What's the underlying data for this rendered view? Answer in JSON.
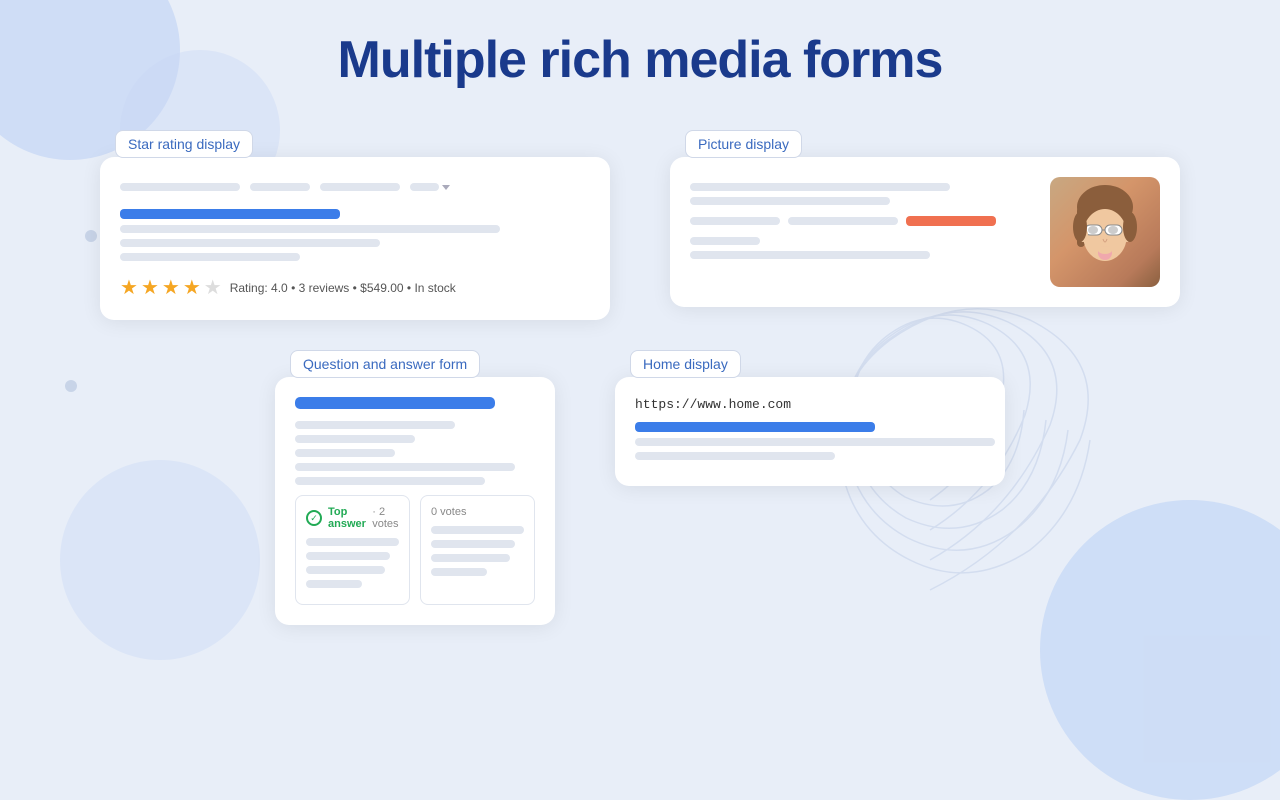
{
  "page": {
    "title": "Multiple rich media forms",
    "background_color": "#e8eef8"
  },
  "cards": {
    "star_rating": {
      "label": "Star rating display",
      "stars_filled": 4,
      "stars_empty": 1,
      "rating_text": "Rating: 4.0",
      "reviews_text": "3 reviews",
      "price_text": "$549.00",
      "stock_text": "In stock"
    },
    "picture_display": {
      "label": "Picture display"
    },
    "qa_form": {
      "label": "Question and answer form",
      "top_answer_label": "Top answer",
      "top_votes": "2 votes",
      "other_votes": "0 votes"
    },
    "home_display": {
      "label": "Home display",
      "url": "https://www.home.com"
    }
  }
}
